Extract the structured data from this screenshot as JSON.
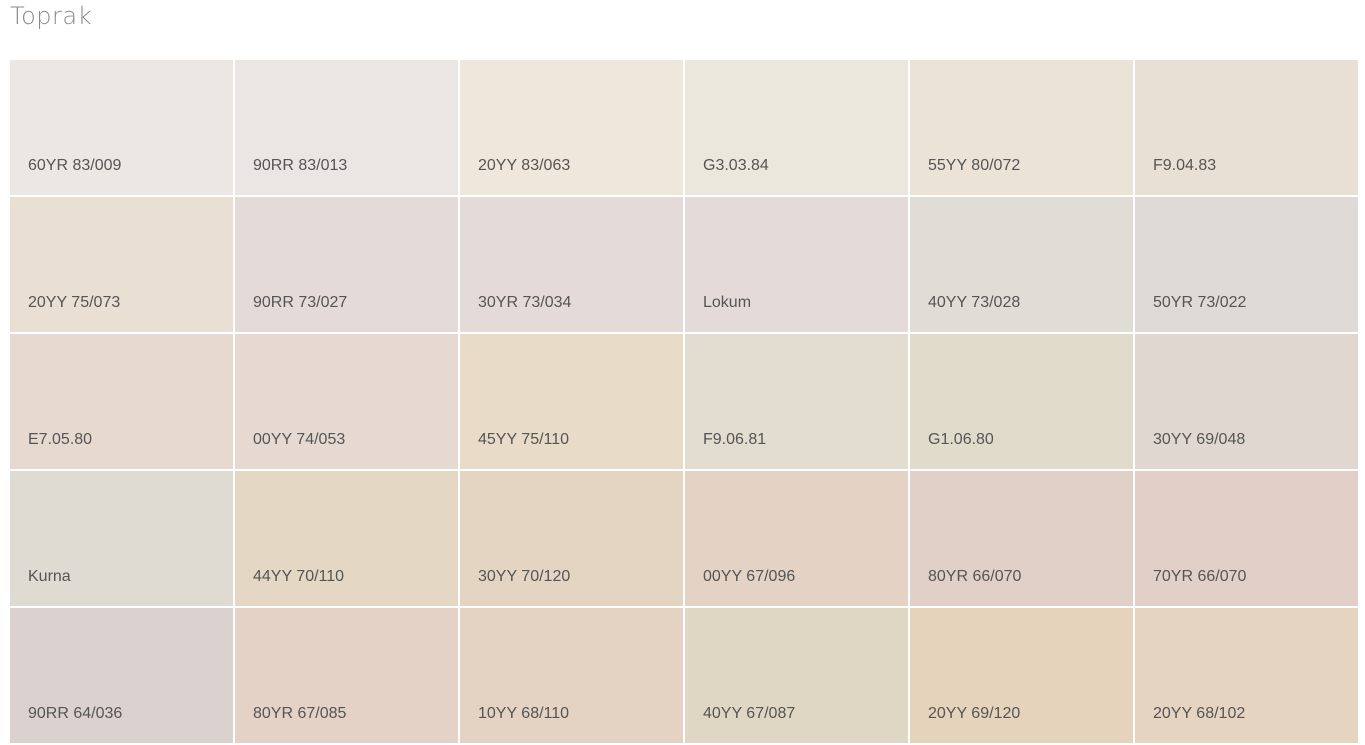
{
  "page_title": "Toprak",
  "swatches": [
    {
      "code": "60YR 83/009",
      "color": "#ebe7e3"
    },
    {
      "code": "90RR 83/013",
      "color": "#ebe5e4"
    },
    {
      "code": "20YY 83/063",
      "color": "#efe7dc"
    },
    {
      "code": "G3.03.84",
      "color": "#ebe7dd"
    },
    {
      "code": "55YY 80/072",
      "color": "#ebe4d6"
    },
    {
      "code": "F9.04.83",
      "color": "#e8e0d5"
    },
    {
      "code": "20YY 75/073",
      "color": "#e9dfd2"
    },
    {
      "code": "90RR 73/027",
      "color": "#e4dbd9"
    },
    {
      "code": "30YR 73/034",
      "color": "#e4dad7"
    },
    {
      "code": "Lokum",
      "color": "#e4dad7"
    },
    {
      "code": "40YY 73/028",
      "color": "#e0ddd6"
    },
    {
      "code": "50YR 73/022",
      "color": "#e0dad6"
    },
    {
      "code": "E7.05.80",
      "color": "#e6d9d0"
    },
    {
      "code": "00YY 74/053",
      "color": "#e6d9d2"
    },
    {
      "code": "45YY 75/110",
      "color": "#e8dcc8"
    },
    {
      "code": "F9.06.81",
      "color": "#e3dcd0"
    },
    {
      "code": "G1.06.80",
      "color": "#e0dbca"
    },
    {
      "code": "30YY 69/048",
      "color": "#e0d8d0"
    },
    {
      "code": "Kurna",
      "color": "#e0dbd2"
    },
    {
      "code": "44YY 70/110",
      "color": "#e4d7c3"
    },
    {
      "code": "30YY 70/120",
      "color": "#e4d5c3"
    },
    {
      "code": "00YY 67/096",
      "color": "#e4d2c4"
    },
    {
      "code": "80YR 66/070",
      "color": "#e0d0c7"
    },
    {
      "code": "70YR 66/070",
      "color": "#e2d0c8"
    },
    {
      "code": "90RR 64/036",
      "color": "#dbd1cf"
    },
    {
      "code": "80YR 67/085",
      "color": "#e4d2c6"
    },
    {
      "code": "10YY 68/110",
      "color": "#e4d3c2"
    },
    {
      "code": "40YY 67/087",
      "color": "#e0d6c4"
    },
    {
      "code": "20YY 69/120",
      "color": "#e6d3bc"
    },
    {
      "code": "20YY 68/102",
      "color": "#e4d4c0"
    }
  ]
}
